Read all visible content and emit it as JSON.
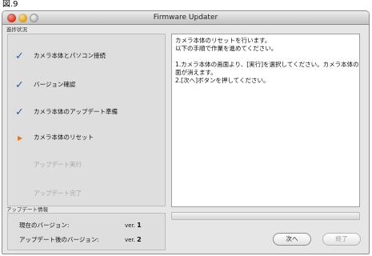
{
  "figure_label": "図.9",
  "window": {
    "title": "Firmware Updater"
  },
  "progress_group": {
    "label": "進捗状況",
    "steps": [
      {
        "label": "カメラ本体とパソコン接続",
        "state": "done",
        "mark": "✓"
      },
      {
        "label": "バージョン確認",
        "state": "done",
        "mark": "✓"
      },
      {
        "label": "カメラ本体のアップデート準備",
        "state": "done",
        "mark": "✓"
      },
      {
        "label": "カメラ本体のリセット",
        "state": "current",
        "mark": "▶"
      },
      {
        "label": "アップデート実行",
        "state": "pending",
        "mark": ""
      },
      {
        "label": "アップデート完了",
        "state": "pending",
        "mark": ""
      }
    ]
  },
  "instructions": {
    "lines": [
      "カメラ本体のリセットを行います。",
      "以下の手順で作業を進めてください。",
      "",
      "1.カメラ本体の画面より、[実行]を選択してください。カメラ本体の画",
      "面が消えます。",
      "2.[次へ]ボタンを押してください。"
    ]
  },
  "update_info": {
    "label": "アップデート情報",
    "current_version_label": "現在のバージョン:",
    "current_version_prefix": "ver.",
    "current_version": "1",
    "new_version_label": "アップデート後のバージョン:",
    "new_version_prefix": "ver.",
    "new_version": "2"
  },
  "progress_bar": {
    "fraction": 0.0
  },
  "buttons": {
    "next_label": "次へ",
    "finish_label": "終了"
  },
  "colors": {
    "check": "#2b5fa8",
    "current": "#e07a1e",
    "pending_text": "#a6a6a6"
  }
}
